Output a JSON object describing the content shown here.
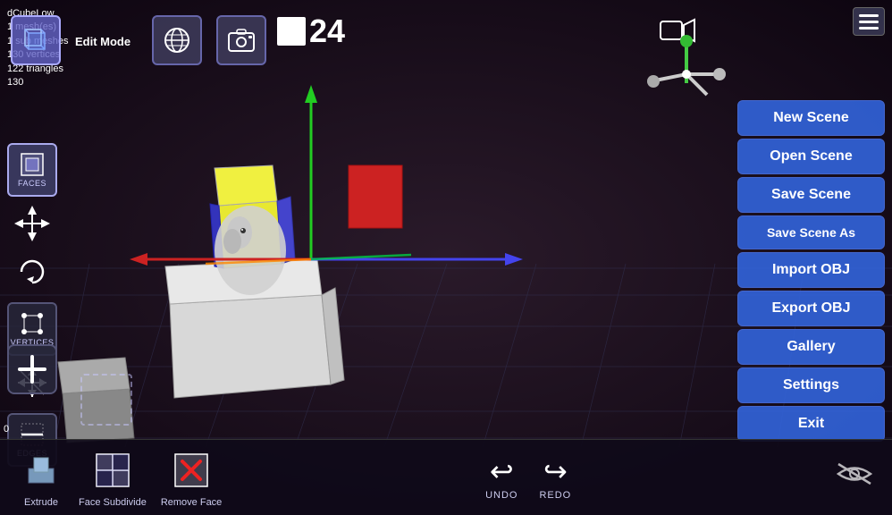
{
  "info": {
    "object_name": "dCubeLow",
    "mesh_count": "1 mesh(es)",
    "sub_meshes": "1 sub meshes",
    "vertices": "130 vertices",
    "triangles": "122 triangles",
    "lod": "130",
    "mode_label": "Edit Mode"
  },
  "frame": {
    "number": "24",
    "square_label": ""
  },
  "menu": {
    "new_scene": "New Scene",
    "open_scene": "Open Scene",
    "save_scene": "Save Scene",
    "save_scene_as": "Save Scene As",
    "import_obj": "Import OBJ",
    "export_obj": "Export OBJ",
    "gallery": "Gallery",
    "settings": "Settings",
    "exit": "Exit"
  },
  "left_tools": [
    {
      "id": "faces",
      "label": "FACES",
      "icon": "▣"
    },
    {
      "id": "vertices",
      "label": "VERTICES",
      "icon": "⬡"
    },
    {
      "id": "edges",
      "label": "EDGES",
      "icon": "⧄"
    }
  ],
  "bottom_tools": [
    {
      "id": "extrude",
      "label": "Extrude"
    },
    {
      "id": "face-subdivide",
      "label": "Face Subdivide"
    },
    {
      "id": "remove-face",
      "label": "Remove Face"
    }
  ],
  "undo_redo": {
    "undo_label": "UNDO",
    "redo_label": "REDO"
  },
  "coords": "0",
  "toolbar_icons": {
    "cube_tooltip": "Edit Mode Cube",
    "globe_tooltip": "Globe/World",
    "camera_photo_tooltip": "Screenshot",
    "video_camera_tooltip": "Video Camera",
    "hamburger_tooltip": "Menu"
  }
}
